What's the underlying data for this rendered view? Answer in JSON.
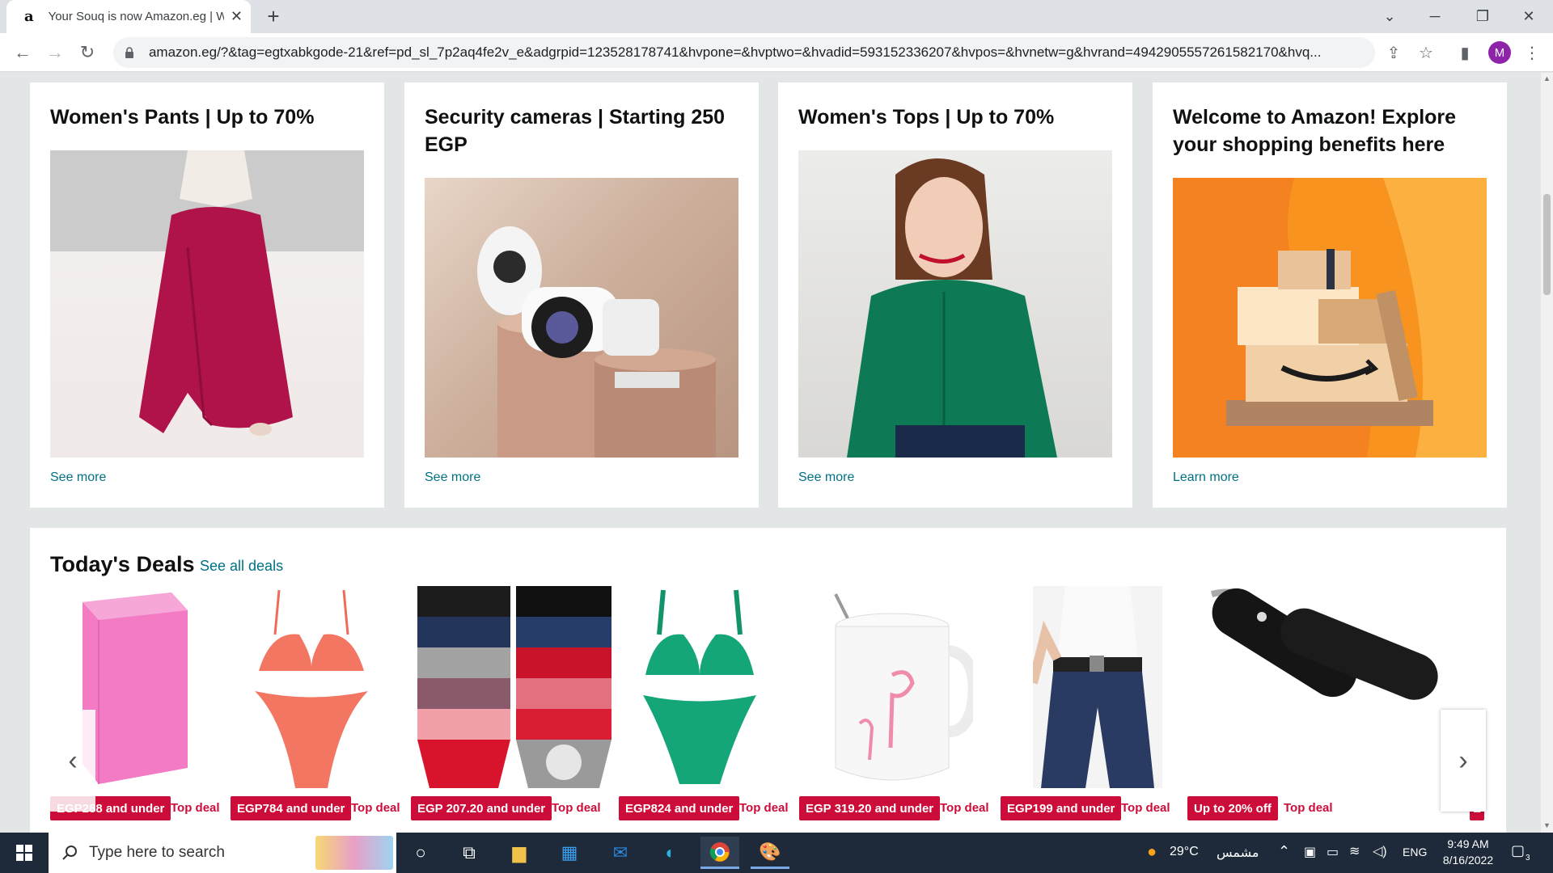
{
  "browser": {
    "tab_title": "Your Souq is now Amazon.eg | W",
    "tab_favicon": "a",
    "url": "amazon.eg/?&tag=egtxabkgode-21&ref=pd_sl_7p2aq4fe2v_e&adgrpid=123528178741&hvpone=&hvptwo=&hvadid=593152336207&hvpos=&hvnetw=g&hvrand=4942905557261582170&hvq...",
    "avatar_letter": "M"
  },
  "cards": [
    {
      "title": "Women's Pants | Up to 70%",
      "link": "See more"
    },
    {
      "title": "Security cameras | Starting 250 EGP",
      "link": "See more"
    },
    {
      "title": "Women's Tops | Up to 70%",
      "link": "See more"
    },
    {
      "title": "Welcome to Amazon! Explore your shopping benefits here",
      "link": "Learn more"
    }
  ],
  "deals": {
    "title": "Today's Deals",
    "see_all": "See all deals",
    "items": [
      {
        "badge": "EGP288 and under",
        "tag": "Top deal"
      },
      {
        "badge": "EGP784 and under",
        "tag": "Top deal"
      },
      {
        "badge": "EGP 207.20 and under",
        "tag": "Top deal"
      },
      {
        "badge": "EGP824 and under",
        "tag": "Top deal"
      },
      {
        "badge": "EGP 319.20 and under",
        "tag": "Top deal"
      },
      {
        "badge": "EGP199 and under",
        "tag": "Top deal"
      },
      {
        "badge": "Up to 20% off",
        "tag": "Top deal"
      },
      {
        "badge": "E",
        "tag": ""
      }
    ]
  },
  "taskbar": {
    "search_placeholder": "Type here to search",
    "weather": "29°C",
    "weather_desc": "مشمس",
    "lang": "ENG",
    "time": "9:49 AM",
    "date": "8/16/2022",
    "notification_count": "3"
  },
  "colors": {
    "deal_red": "#cc0c39",
    "link_teal": "#007185",
    "page_bg": "#e3e6e6"
  }
}
